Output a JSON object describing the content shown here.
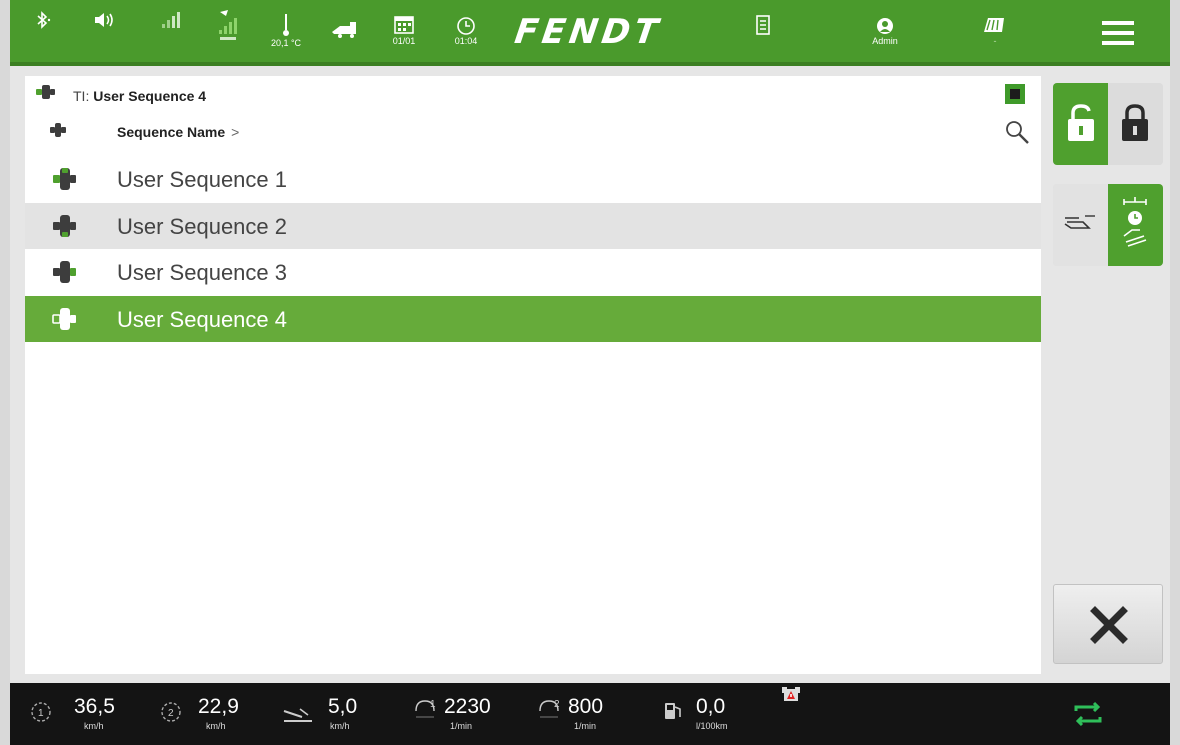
{
  "topbar": {
    "temperature": "20,1 °C",
    "counter": "01/01",
    "time": "01:04",
    "brand": "FENDT",
    "user": "Admin",
    "user_sub": "-",
    "accent": "#4a9a2c"
  },
  "header": {
    "ti_prefix": "TI: ",
    "ti_title": "User Sequence 4",
    "column": "Sequence Name",
    "column_chevron": ">"
  },
  "sequences": [
    {
      "label": "User Sequence 1",
      "state": "normal"
    },
    {
      "label": "User Sequence 2",
      "state": "alternate"
    },
    {
      "label": "User Sequence 3",
      "state": "normal"
    },
    {
      "label": "User Sequence 4",
      "state": "selected"
    }
  ],
  "side": {
    "lock_mode": "unlocked",
    "sequence_mode": "timed",
    "close_icon": "close-icon"
  },
  "bottombar": {
    "speed1": {
      "value": "36,5",
      "unit": "km/h"
    },
    "speed2": {
      "value": "22,9",
      "unit": "km/h"
    },
    "ground_speed": {
      "value": "5,0",
      "unit": "km/h"
    },
    "rpm1": {
      "value": "2230",
      "unit": "1/min"
    },
    "rpm2": {
      "value": "800",
      "unit": "1/min"
    },
    "fuel": {
      "value": "0,0",
      "unit": "l/100km"
    },
    "highlight": "#2fbf5a"
  }
}
